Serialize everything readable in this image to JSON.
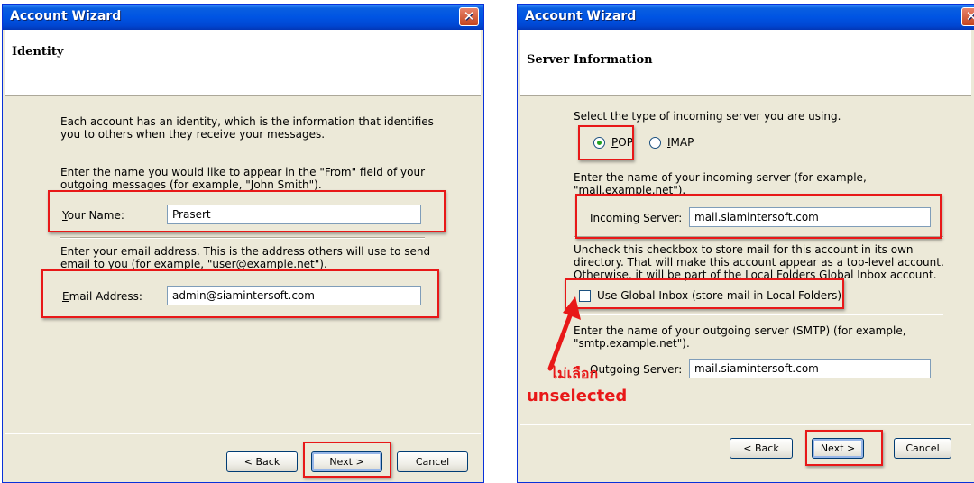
{
  "left": {
    "title": "Account Wizard",
    "close_glyph": "✕",
    "header": "Identity",
    "intro_line1": "Each account has an identity, which is the information that identifies",
    "intro_line2": "you to others when they receive your messages.",
    "name_prompt1": "Enter the name you would like to appear in the \"From\" field of your",
    "name_prompt2": "outgoing messages (for example, \"John Smith\").",
    "name_label_accel": "Y",
    "name_label_rest": "our Name:",
    "name_value": "Prasert",
    "email_prompt1": "Enter your email address. This is the address others will use to send",
    "email_prompt2": "email to you (for example, \"user@example.net\").",
    "email_label_accel": "E",
    "email_label_rest": "mail Address:",
    "email_value": "admin@siamintersoft.com",
    "back_label": "< Back",
    "next_label": "Next >",
    "cancel_label": "Cancel"
  },
  "right": {
    "title": "Account Wizard",
    "close_glyph": "✕",
    "header": "Server Information",
    "select_prompt": "Select the type of incoming server you are using.",
    "pop_accel": "P",
    "pop_rest": "OP",
    "imap_accel": "I",
    "imap_rest": "MAP",
    "selected_server_type": "POP",
    "incoming_prompt1": "Enter the name of your incoming server (for example,",
    "incoming_prompt2": "\"mail.example.net\").",
    "incoming_label_pre": "Incoming ",
    "incoming_label_accel": "S",
    "incoming_label_rest": "erver:",
    "incoming_value": "mail.siamintersoft.com",
    "uncheck_line1": "Uncheck this checkbox to store mail for this account in its own",
    "uncheck_line2": "directory. That will make this account appear as a top-level account.",
    "uncheck_line3": "Otherwise, it will be part of the Local Folders Global Inbox account.",
    "global_inbox_label": "Use Global Inbox (store mail in Local Folders)",
    "global_inbox_checked": false,
    "outgoing_prompt1": "Enter the name of your outgoing server (SMTP) (for example,",
    "outgoing_prompt2": "\"smtp.example.net\").",
    "outgoing_label": "Outgoing Server:",
    "outgoing_value": "mail.siamintersoft.com",
    "annotation_thai": "ไม่เลือก",
    "annotation_en": "unselected",
    "back_label": "< Back",
    "next_label": "Next >",
    "cancel_label": "Cancel"
  },
  "colors": {
    "highlight": "#e81818",
    "titlebar": "#0054e3",
    "dialog_bg": "#ece9d8"
  }
}
